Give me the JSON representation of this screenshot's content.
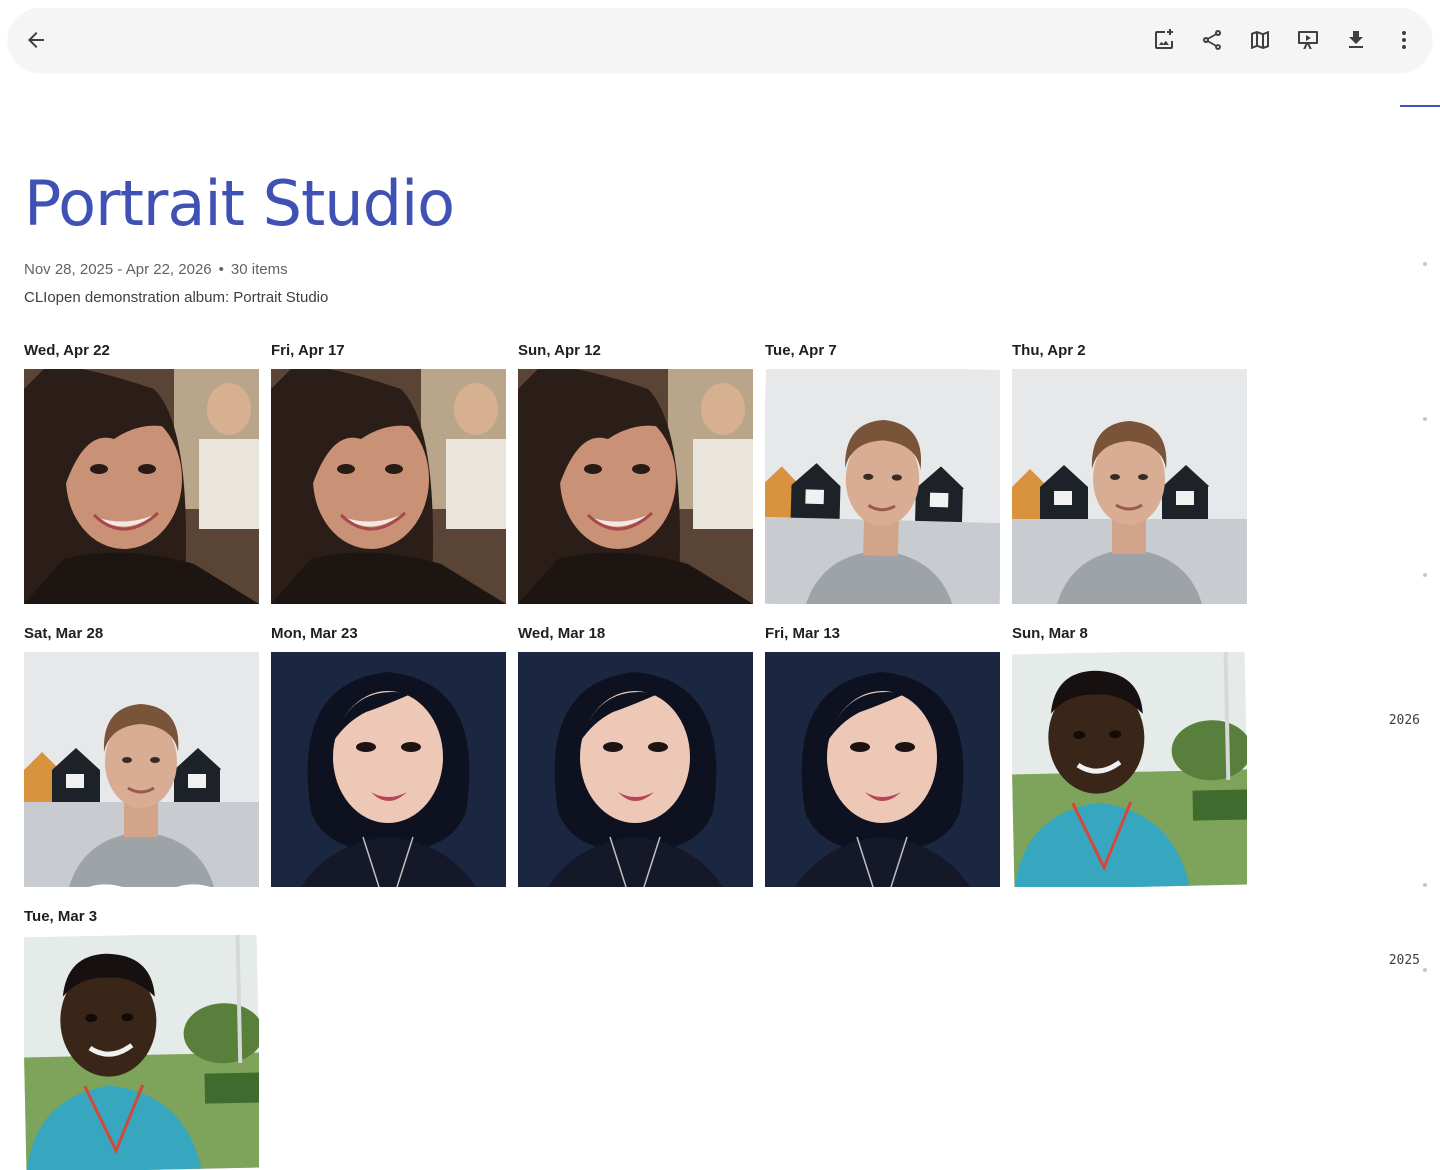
{
  "toolbar": {
    "back": "arrow-back-icon",
    "actions": [
      {
        "name": "add-photos-icon"
      },
      {
        "name": "share-icon"
      },
      {
        "name": "map-icon"
      },
      {
        "name": "slideshow-icon"
      },
      {
        "name": "download-icon"
      },
      {
        "name": "more-options-icon"
      }
    ]
  },
  "album": {
    "title": "Portrait Studio",
    "date_range": "Nov 28, 2025 - Apr 22, 2026",
    "separator": "•",
    "item_count": "30 items",
    "description": "CLIopen demonstration album: Portrait Studio"
  },
  "photos": [
    {
      "date": "Wed, Apr 22",
      "subject": "woman-long-hair",
      "favorite": false
    },
    {
      "date": "Fri, Apr 17",
      "subject": "woman-long-hair",
      "favorite": false
    },
    {
      "date": "Sun, Apr 12",
      "subject": "woman-long-hair",
      "favorite": false
    },
    {
      "date": "Tue, Apr 7",
      "subject": "man-boathouses-rotated",
      "favorite": false
    },
    {
      "date": "Thu, Apr 2",
      "subject": "man-boathouses",
      "favorite": false
    },
    {
      "date": "Sat, Mar 28",
      "subject": "man-boathouses",
      "favorite": true
    },
    {
      "date": "Mon, Mar 23",
      "subject": "woman-bob-hair",
      "favorite": false
    },
    {
      "date": "Wed, Mar 18",
      "subject": "woman-bob-hair",
      "favorite": false
    },
    {
      "date": "Fri, Mar 13",
      "subject": "woman-bob-hair",
      "favorite": false
    },
    {
      "date": "Sun, Mar 8",
      "subject": "man-outdoors",
      "favorite": false
    },
    {
      "date": "Tue, Mar 3",
      "subject": "man-outdoors",
      "favorite": false
    }
  ],
  "timeline": {
    "years": [
      "2026",
      "2025"
    ]
  },
  "colors": {
    "accent": "#3f51b5",
    "toolbar_bg": "#f5f5f5"
  }
}
